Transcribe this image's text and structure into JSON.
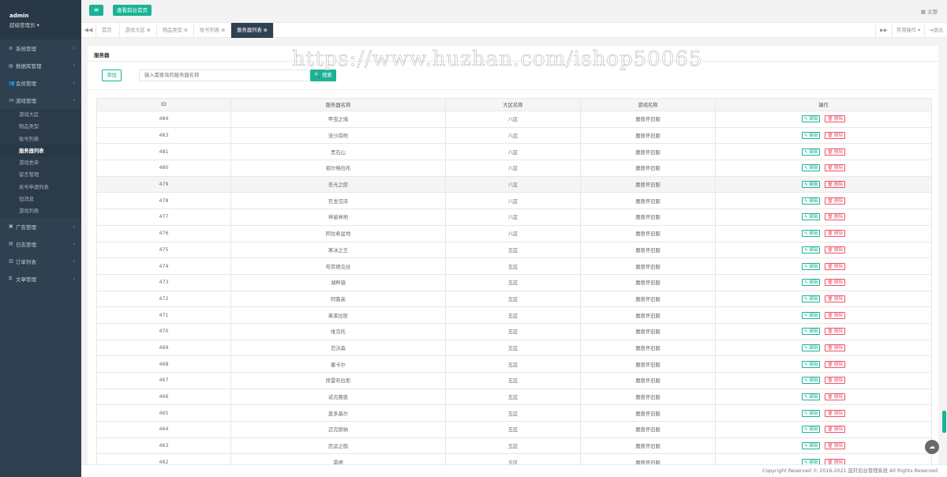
{
  "sidebar": {
    "user_name": "admin",
    "user_role": "超级管理员 ▾",
    "menu": [
      {
        "icon": "⚙",
        "label": "系统管理"
      },
      {
        "icon": "▤",
        "label": "数据库管理"
      },
      {
        "icon": "👥",
        "label": "会员管理"
      },
      {
        "icon": "🎮",
        "label": "游戏管理"
      }
    ],
    "game_sub": [
      "游戏大区",
      "物品类型",
      "账号列表",
      "服务器列表",
      "游戏类单",
      "留言管理",
      "卖号申请列表",
      "短消息",
      "游戏列表"
    ],
    "menu2": [
      {
        "icon": "▣",
        "label": "广告管理"
      },
      {
        "icon": "▤",
        "label": "日志管理"
      },
      {
        "icon": "▥",
        "label": "订单列表"
      },
      {
        "icon": "⧉",
        "label": "文章管理"
      }
    ]
  },
  "topbar": {
    "menu_icon": "≡",
    "front_button": "查看前台首页",
    "theme": "主题"
  },
  "tabs": {
    "items": [
      {
        "label": "首页",
        "close": ""
      },
      {
        "label": "游戏大区",
        "close": "⊗"
      },
      {
        "label": "物品类型",
        "close": "⊗"
      },
      {
        "label": "账号列表",
        "close": "⊗"
      },
      {
        "label": "服务器列表",
        "close": "⊗"
      }
    ],
    "common_ops": "常用操作 ▾",
    "logout": "⇥退出"
  },
  "panel": {
    "title": "服务器",
    "add_button": "添加",
    "search_placeholder": "输入需查询的服务器名称",
    "search_button": "🔍 搜索"
  },
  "table": {
    "headers": [
      "ID",
      "服务器名称",
      "大区名称",
      "游戏名称",
      "操作"
    ],
    "edit_label": "✎ 编辑",
    "delete_label": "🗑 删除",
    "rows": [
      [
        "484",
        "甲虫之墙",
        "八区",
        "魔兽怀旧服"
      ],
      [
        "483",
        "流沙岗哨",
        "八区",
        "魔兽怀旧服"
      ],
      [
        "481",
        "黑石山",
        "八区",
        "魔兽怀旧服"
      ],
      [
        "480",
        "祖尔格拉布",
        "八区",
        "魔兽怀旧服"
      ],
      [
        "479",
        "圣光之愿",
        "八区",
        "魔兽怀旧服"
      ],
      [
        "478",
        "巨龙沼泽",
        "八区",
        "魔兽怀旧服"
      ],
      [
        "477",
        "神谕林地",
        "八区",
        "魔兽怀旧服"
      ],
      [
        "476",
        "阿拉希盆地",
        "八区",
        "魔兽怀旧服"
      ],
      [
        "475",
        "寒冰之王",
        "五区",
        "魔兽怀旧服"
      ],
      [
        "474",
        "布劳德克丝",
        "五区",
        "魔兽怀旧服"
      ],
      [
        "473",
        "湖畔镇",
        "五区",
        "魔兽怀旧服"
      ],
      [
        "472",
        "阿鲁高",
        "五区",
        "魔兽怀旧服"
      ],
      [
        "471",
        "弗莱拉斯",
        "五区",
        "魔兽怀旧服"
      ],
      [
        "470",
        "维克托",
        "五区",
        "魔兽怀旧服"
      ],
      [
        "469",
        "范沃森",
        "五区",
        "魔兽怀旧服"
      ],
      [
        "468",
        "塞卡尔",
        "五区",
        "魔兽怀旧服"
      ],
      [
        "467",
        "席雷布拉斯",
        "五区",
        "魔兽怀旧服"
      ],
      [
        "466",
        "诺克赛恩",
        "五区",
        "魔兽怀旧服"
      ],
      [
        "465",
        "莫多基尔",
        "五区",
        "魔兽怀旧服"
      ],
      [
        "464",
        "迈克斯纳",
        "五区",
        "魔兽怀旧服"
      ],
      [
        "463",
        "厄运之槌",
        "五区",
        "魔兽怀旧服"
      ],
      [
        "462",
        "雷德",
        "五区",
        "魔兽怀旧服"
      ]
    ]
  },
  "watermark": "https://www.huzhan.com/ishop50065",
  "footer": "Copyright Reserved © 2016-2021 蓝轩后台管理系统 All Rights Reserved",
  "colors": {
    "accent": "#1ab394",
    "sidebar": "#2f4050",
    "danger": "#ed5565"
  }
}
